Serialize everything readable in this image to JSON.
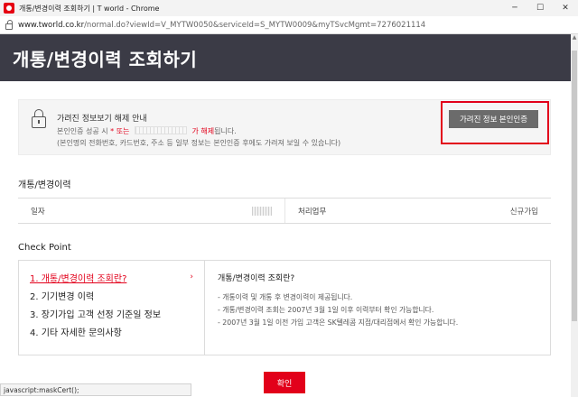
{
  "window": {
    "title": "개통/변경이력 조회하기 | T world - Chrome",
    "min_label": "─",
    "max_label": "☐",
    "close_label": "✕"
  },
  "address": {
    "host": "www.tworld.co.kr",
    "path": "/normal.do?viewId=V_MYTW0050&serviceId=S_MYTW0009&myTSvcMgmt=7276021114"
  },
  "header": {
    "title": "개통/변경이력 조회하기"
  },
  "notice": {
    "title": "가려진 정보보기 해제 안내",
    "line1_prefix": "본인인증 성공 시",
    "line1_star": "* 또는",
    "line1_mid": "가 해제",
    "line1_suffix": "됩니다.",
    "line2": "(본인명의 전화번호, 카드번호, 주소 등 일부 정보는 본인인증 후에도 가려져 보일 수 있습니다)",
    "button_label": "가려진 정보 본인인증"
  },
  "history": {
    "section_title": "개통/변경이력",
    "date_label": "일자",
    "work_label": "처리업무",
    "work_value": "신규가입"
  },
  "checkpoint": {
    "section_title": "Check Point",
    "items": [
      {
        "label": "1. 개통/변경이력 조회란?",
        "chevron": "›"
      },
      {
        "label": "2. 기기변경 이력"
      },
      {
        "label": "3. 장기가입 고객 선정 기준일 정보"
      },
      {
        "label": "4. 기타 자세한 문의사항"
      }
    ],
    "detail_title": "개통/변경이력 조회란?",
    "detail_bullets": [
      "- 개통이력 및 개통 후 변경이력이 제공됩니다.",
      "- 개통/변경이력 조회는 2007년 3월 1일 이후 이력부터 확인 가능합니다.",
      "- 2007년 3월 1일 이전 가입 고객은 SK텔레콤 지점/대리점에서 확인 가능합니다."
    ]
  },
  "confirm_label": "확인",
  "status_text": "javascript:maskCert();",
  "colors": {
    "header_bg": "#3b3b46",
    "accent": "#e2001a",
    "cert_button": "#6b6b6b"
  }
}
